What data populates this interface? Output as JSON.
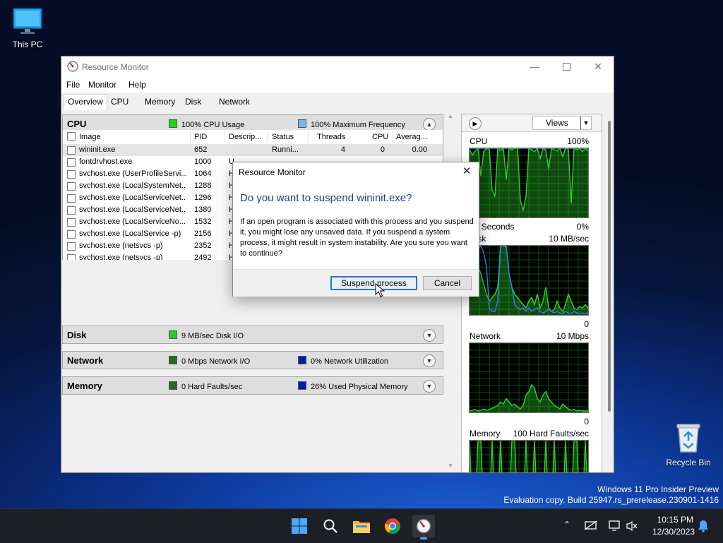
{
  "desktop": {
    "this_pc_label": "This PC",
    "recycle_label": "Recycle Bin",
    "watermark_line1": "Windows 11 Pro Insider Preview",
    "watermark_line2": "Evaluation copy. Build 25947.rs_prerelease.230901-1416"
  },
  "window": {
    "title": "Resource Monitor",
    "menu": [
      "File",
      "Monitor",
      "Help"
    ],
    "tabs": [
      "Overview",
      "CPU",
      "Memory",
      "Disk",
      "Network"
    ],
    "selected_tab": "Overview"
  },
  "cpu_section": {
    "title": "CPU",
    "legend1": "100% CPU Usage",
    "legend2": "100% Maximum Frequency",
    "legend1_color": "#1fd21f",
    "legend2_color": "#7ab4ea",
    "columns": [
      "Image",
      "PID",
      "Descrip...",
      "Status",
      "Threads",
      "CPU",
      "Averag..."
    ],
    "processes": [
      {
        "image": "wininit.exe",
        "pid": "652",
        "desc": "",
        "status": "Runni...",
        "threads": "4",
        "cpu": "0",
        "avg": "0.00"
      },
      {
        "image": "fontdrvhost.exe",
        "pid": "1000",
        "desc": "U",
        "status": "",
        "threads": "",
        "cpu": "",
        "avg": ""
      },
      {
        "image": "svchost.exe (UserProfileServi...",
        "pid": "1064",
        "desc": "H",
        "status": "",
        "threads": "",
        "cpu": "",
        "avg": ""
      },
      {
        "image": "svchost.exe (LocalSystemNet...",
        "pid": "1288",
        "desc": "H",
        "status": "",
        "threads": "",
        "cpu": "",
        "avg": ""
      },
      {
        "image": "svchost.exe (LocalServiceNet...",
        "pid": "1296",
        "desc": "H",
        "status": "",
        "threads": "",
        "cpu": "",
        "avg": ""
      },
      {
        "image": "svchost.exe (LocalServiceNet...",
        "pid": "1380",
        "desc": "H",
        "status": "",
        "threads": "",
        "cpu": "",
        "avg": ""
      },
      {
        "image": "svchost.exe (LocalServiceNo...",
        "pid": "1532",
        "desc": "H",
        "status": "",
        "threads": "",
        "cpu": "",
        "avg": ""
      },
      {
        "image": "svchost.exe (LocalService -p)",
        "pid": "2156",
        "desc": "H",
        "status": "",
        "threads": "",
        "cpu": "",
        "avg": ""
      },
      {
        "image": "svchost.exe (netsvcs -p)",
        "pid": "2352",
        "desc": "H",
        "status": "",
        "threads": "",
        "cpu": "",
        "avg": ""
      },
      {
        "image": "svchost.exe (netsvcs -p)",
        "pid": "2492",
        "desc": "H",
        "status": "",
        "threads": "",
        "cpu": "",
        "avg": ""
      }
    ]
  },
  "disk_section": {
    "title": "Disk",
    "legend1": "9 MB/sec Disk I/O",
    "legend1_color": "#1fd21f"
  },
  "network_section": {
    "title": "Network",
    "legend1": "0 Mbps Network I/O",
    "legend2": "0% Network Utilization",
    "legend1_color": "#1f6e1f",
    "legend2_color": "#0a1aa8"
  },
  "memory_section": {
    "title": "Memory",
    "legend1": "0 Hard Faults/sec",
    "legend2": "26% Used Physical Memory",
    "legend1_color": "#1f6e1f",
    "legend2_color": "#0a1aa8"
  },
  "graphs": {
    "views_label": "Views",
    "cpu": {
      "title": "CPU",
      "max": "100%",
      "bottom_left": "60 Seconds",
      "bottom_right": "0%"
    },
    "disk": {
      "title": "Disk",
      "max": "10 MB/sec",
      "bottom_right": "0"
    },
    "network": {
      "title": "Network",
      "max": "10 Mbps",
      "bottom_right": "0"
    },
    "memory": {
      "title": "Memory",
      "max": "100 Hard Faults/sec"
    }
  },
  "dialog": {
    "title": "Resource Monitor",
    "heading": "Do you want to suspend wininit.exe?",
    "body": "If an open program is associated with this process and you suspend it, you might lose any unsaved data. If you suspend a system process, it might result in system instability. Are you sure you want to continue?",
    "confirm_label": "Suspend process",
    "cancel_label": "Cancel"
  },
  "taskbar": {
    "time": "10:15 PM",
    "date": "12/30/2023"
  },
  "colors": {
    "graph_green": "#2ed12e",
    "graph_blue": "#3b78ff",
    "accent": "#2f72c9"
  }
}
